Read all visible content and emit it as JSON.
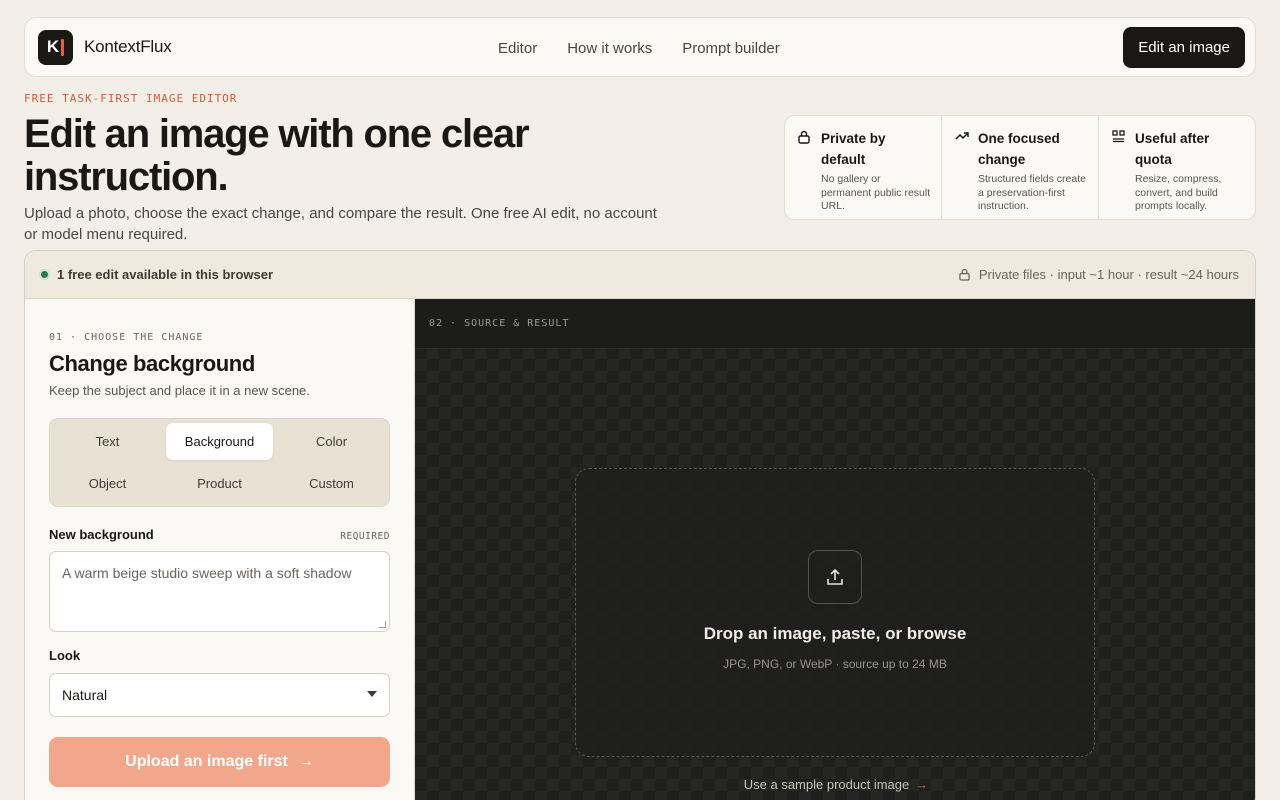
{
  "nav": {
    "logo_letter": "K",
    "brand": "KontextFlux",
    "links": [
      "Editor",
      "How it works",
      "Prompt builder"
    ],
    "cta": "Edit an image"
  },
  "hero": {
    "eyebrow": "FREE TASK-FIRST IMAGE EDITOR",
    "title": "Edit an image with one clear instruction.",
    "subtitle": "Upload a photo, choose the exact change, and compare the result. One free AI edit, no account or model menu required."
  },
  "features": [
    {
      "icon": "lock-icon",
      "title": "Private by default",
      "desc": "No gallery or permanent public result URL."
    },
    {
      "icon": "trend-icon",
      "title": "One focused change",
      "desc": "Structured fields create a preservation-first instruction."
    },
    {
      "icon": "tools-icon",
      "title": "Useful after quota",
      "desc": "Resize, compress, convert, and build prompts locally."
    }
  ],
  "status": {
    "left": "1 free edit available in this browser",
    "right": "Private files · input ~1 hour · result ~24 hours"
  },
  "editor": {
    "step": "01 · CHOOSE THE CHANGE",
    "title": "Change background",
    "desc": "Keep the subject and place it in a new scene.",
    "tabs": [
      "Text",
      "Background",
      "Color",
      "Object",
      "Product",
      "Custom"
    ],
    "active_tab": "Background",
    "field_label": "New background",
    "field_required": "REQUIRED",
    "field_placeholder": "A warm beige studio sweep with a soft shadow",
    "look_label": "Look",
    "look_value": "Natural",
    "submit_label": "Upload an image first",
    "submit_arrow": "→"
  },
  "preview": {
    "step": "02 · SOURCE & RESULT",
    "drop_title": "Drop an image, paste, or browse",
    "drop_sub": "JPG, PNG, or WebP · source up to 24 MB",
    "sample_link": "Use a sample product image",
    "sample_arrow": "→"
  },
  "colors": {
    "accent": "#e4603a",
    "submit_disabled": "#f2a78d",
    "status_dot": "#2c7a4f",
    "dark": "#1a1815"
  }
}
